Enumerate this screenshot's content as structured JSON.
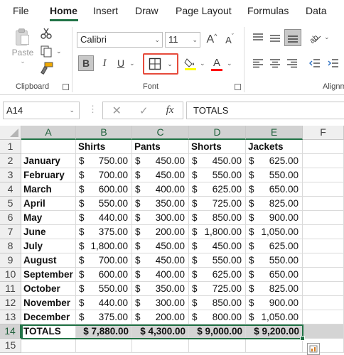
{
  "menu": {
    "tabs": [
      {
        "label": "File"
      },
      {
        "label": "Home"
      },
      {
        "label": "Insert"
      },
      {
        "label": "Draw"
      },
      {
        "label": "Page Layout"
      },
      {
        "label": "Formulas"
      },
      {
        "label": "Data"
      }
    ],
    "active_tab": "Home"
  },
  "ribbon": {
    "clipboard": {
      "paste_label": "Paste",
      "group_label": "Clipboard"
    },
    "font": {
      "font_name": "Calibri",
      "font_size": "11",
      "bold": "B",
      "italic": "I",
      "underline": "U",
      "group_label": "Font",
      "grow": "A",
      "shrink": "A",
      "font_color_letter": "A"
    },
    "alignment": {
      "group_label": "Alignm"
    },
    "colors": {
      "accent": "#217346",
      "highlight_yellow": "#ffff00",
      "font_red": "#ff0000",
      "borders_outline": "#e64b3c"
    }
  },
  "formula_bar": {
    "name_box": "A14",
    "fx": "fx",
    "content": "TOTALS"
  },
  "grid": {
    "columns": [
      "A",
      "B",
      "C",
      "D",
      "E",
      "F"
    ],
    "selected_columns": [
      "A",
      "B",
      "C",
      "D",
      "E"
    ],
    "rows": [
      {
        "n": "1",
        "cells": [
          "",
          "Shirts",
          "Pants",
          "Shorts",
          "Jackets"
        ]
      },
      {
        "n": "2",
        "cells": [
          "January",
          "750.00",
          "450.00",
          "450.00",
          "625.00"
        ]
      },
      {
        "n": "3",
        "cells": [
          "February",
          "700.00",
          "450.00",
          "550.00",
          "550.00"
        ]
      },
      {
        "n": "4",
        "cells": [
          "March",
          "600.00",
          "400.00",
          "625.00",
          "650.00"
        ]
      },
      {
        "n": "5",
        "cells": [
          "April",
          "550.00",
          "350.00",
          "725.00",
          "825.00"
        ]
      },
      {
        "n": "6",
        "cells": [
          "May",
          "440.00",
          "300.00",
          "850.00",
          "900.00"
        ]
      },
      {
        "n": "7",
        "cells": [
          "June",
          "375.00",
          "200.00",
          "1,800.00",
          "1,050.00"
        ]
      },
      {
        "n": "8",
        "cells": [
          "July",
          "1,800.00",
          "450.00",
          "450.00",
          "625.00"
        ]
      },
      {
        "n": "9",
        "cells": [
          "August",
          "700.00",
          "450.00",
          "550.00",
          "550.00"
        ]
      },
      {
        "n": "10",
        "cells": [
          "September",
          "600.00",
          "400.00",
          "625.00",
          "650.00"
        ]
      },
      {
        "n": "11",
        "cells": [
          "October",
          "550.00",
          "350.00",
          "725.00",
          "825.00"
        ]
      },
      {
        "n": "12",
        "cells": [
          "November",
          "440.00",
          "300.00",
          "850.00",
          "900.00"
        ]
      },
      {
        "n": "13",
        "cells": [
          "December",
          "375.00",
          "200.00",
          "800.00",
          "1,050.00"
        ]
      },
      {
        "n": "14",
        "cells": [
          "TOTALS",
          "$ 7,880.00",
          "$ 4,300.00",
          "$ 9,000.00",
          "$ 9,200.00"
        ]
      },
      {
        "n": "15",
        "cells": [
          "",
          "",
          "",
          "",
          ""
        ]
      }
    ],
    "currency_symbol": "$",
    "selected_row": "14"
  }
}
